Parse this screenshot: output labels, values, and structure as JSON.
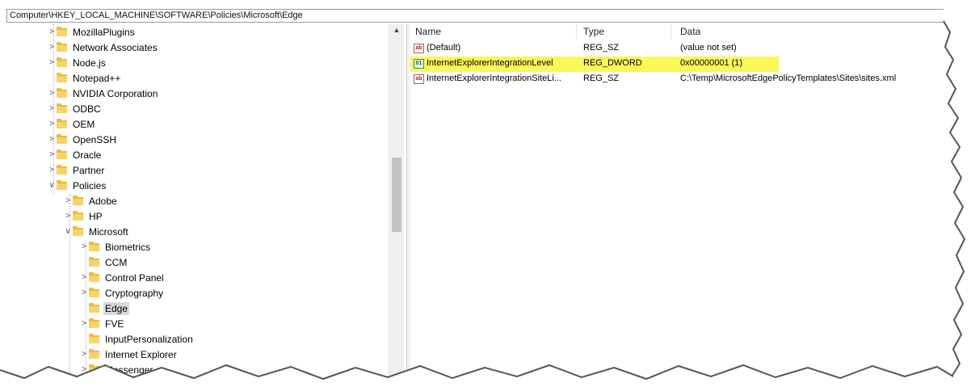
{
  "address_bar": {
    "path": "Computer\\HKEY_LOCAL_MACHINE\\SOFTWARE\\Policies\\Microsoft\\Edge"
  },
  "tree": {
    "items": [
      {
        "label": "MozillaPlugins",
        "expandable": true
      },
      {
        "label": "Network Associates",
        "expandable": true
      },
      {
        "label": "Node.js",
        "expandable": true
      },
      {
        "label": "Notepad++",
        "expandable": false
      },
      {
        "label": "NVIDIA Corporation",
        "expandable": true
      },
      {
        "label": "ODBC",
        "expandable": true
      },
      {
        "label": "OEM",
        "expandable": true
      },
      {
        "label": "OpenSSH",
        "expandable": true
      },
      {
        "label": "Oracle",
        "expandable": true
      },
      {
        "label": "Partner",
        "expandable": true
      },
      {
        "label": "Policies",
        "expanded": true
      },
      {
        "label": "Adobe",
        "expandable": true
      },
      {
        "label": "HP",
        "expandable": true
      },
      {
        "label": "Microsoft",
        "expanded": true
      },
      {
        "label": "Biometrics",
        "expandable": true
      },
      {
        "label": "CCM",
        "expandable": false
      },
      {
        "label": "Control Panel",
        "expandable": true
      },
      {
        "label": "Cryptography",
        "expandable": true
      },
      {
        "label": "Edge",
        "expandable": false,
        "selected": true
      },
      {
        "label": "FVE",
        "expandable": true
      },
      {
        "label": "InputPersonalization",
        "expandable": false
      },
      {
        "label": "Internet Explorer",
        "expandable": true
      },
      {
        "label": "Messenger",
        "expandable": true
      }
    ]
  },
  "values_pane": {
    "columns": {
      "name": "Name",
      "type": "Type",
      "data": "Data"
    },
    "rows": [
      {
        "name": "(Default)",
        "type": "REG_SZ",
        "data": "(value not set)",
        "icon": "string-value-icon"
      },
      {
        "name": "InternetExplorerIntegrationLevel",
        "type": "REG_DWORD",
        "data": "0x00000001 (1)",
        "icon": "dword-value-icon",
        "highlighted": true
      },
      {
        "name": "InternetExplorerIntegrationSiteLi...",
        "type": "REG_SZ",
        "data": "C:\\Temp\\MicrosoftEdgePolicyTemplates\\Sites\\sites.xml",
        "icon": "string-value-icon"
      }
    ]
  },
  "colors": {
    "highlight": "#fbf757",
    "folder": "#f6d46b",
    "selected_row": "#d9d9d9"
  },
  "icons": {
    "folder": "folder-icon",
    "expand": "chevron-right-icon",
    "collapse": "chevron-down-icon"
  }
}
